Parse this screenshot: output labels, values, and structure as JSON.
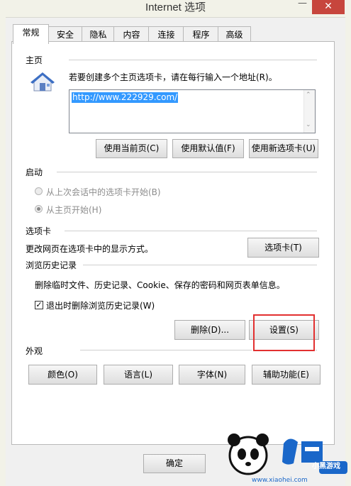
{
  "window": {
    "title": "Internet 选项",
    "close_glyph": "✕",
    "minimize_glyph": "—"
  },
  "tabs": [
    {
      "label": "常规",
      "active": true
    },
    {
      "label": "安全"
    },
    {
      "label": "隐私"
    },
    {
      "label": "内容"
    },
    {
      "label": "连接"
    },
    {
      "label": "程序"
    },
    {
      "label": "高级"
    }
  ],
  "homepage": {
    "heading": "主页",
    "instruction": "若要创建多个主页选项卡，请在每行输入一个地址(R)。",
    "url": "http://www.222929.com/",
    "buttons": {
      "current": "使用当前页(C)",
      "default": "使用默认值(F)",
      "new_tab": "使用新选项卡(U)"
    }
  },
  "startup": {
    "heading": "启动",
    "options": [
      {
        "label": "从上次会话中的选项卡开始(B)",
        "selected": false
      },
      {
        "label": "从主页开始(H)",
        "selected": true
      }
    ]
  },
  "tabs_section": {
    "heading": "选项卡",
    "description": "更改网页在选项卡中的显示方式。",
    "button": "选项卡(T)"
  },
  "history": {
    "heading": "浏览历史记录",
    "description": "删除临时文件、历史记录、Cookie、保存的密码和网页表单信息。",
    "checkbox_label": "退出时删除浏览历史记录(W)",
    "checkbox_checked": true,
    "delete_button": "删除(D)...",
    "settings_button": "设置(S)"
  },
  "appearance": {
    "heading": "外观",
    "buttons": {
      "colors": "颜色(O)",
      "languages": "语言(L)",
      "fonts": "字体(N)",
      "accessibility": "辅助功能(E)"
    }
  },
  "footer": {
    "ok": "确定"
  },
  "watermark": {
    "brand": "小黑游戏",
    "url": "www.xiaohei.com"
  },
  "colors": {
    "highlight": "#e23030",
    "selection": "#3399ff",
    "close": "#c7463d"
  }
}
